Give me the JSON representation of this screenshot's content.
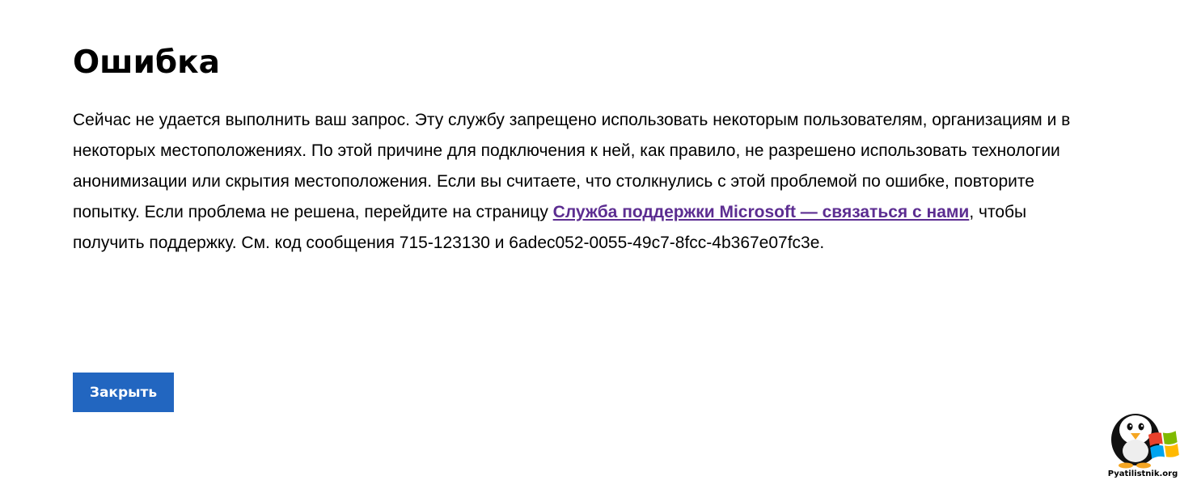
{
  "error": {
    "title": "Ошибка",
    "message": {
      "part1": "Сейчас не удается выполнить ваш запрос. Эту службу запрещено использовать некоторым пользователям, организациям и в некоторых местоположениях. По этой причине для подключения к ней, как правило, не разрешено использовать технологии анонимизации или скрытия местоположения. Если вы считаете, что столкнулись с этой проблемой по ошибке, повторите попытку. Если проблема не решена, перейдите на страницу ",
      "link_text": "Служба поддержки Microsoft — связаться с нами",
      "part2": ", чтобы получить поддержку. См. код сообщения 715-123130 и 6adec052-0055-49c7-8fcc-4b367e07fc3e."
    },
    "close_label": "Закрыть"
  },
  "watermark": {
    "text": "Pyatilistnik.org",
    "icon": "penguin-windows-logo-icon"
  },
  "colors": {
    "button_bg": "#2266c0",
    "link": "#5c2d91"
  }
}
